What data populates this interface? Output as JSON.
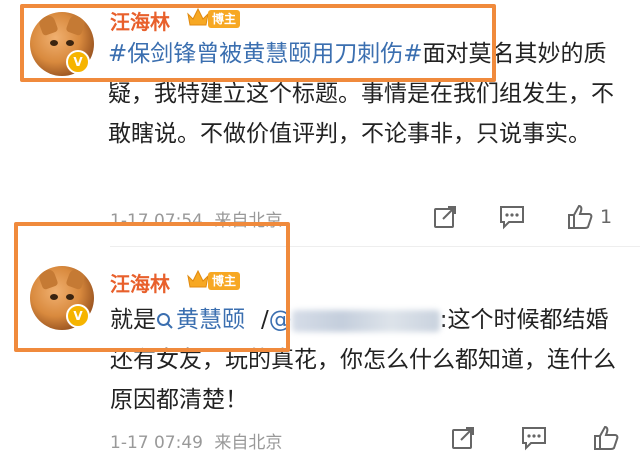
{
  "comments": [
    {
      "user": "汪海林",
      "role_badge": "博主",
      "verified_mark": "V",
      "hashtag": "#保剑锋曾被黄慧颐用刀刺伤#",
      "text_after_hashtag": "面对莫名其妙的质疑，我特建立这个标题。事情是在我们组发生，不敢瞎说。不做价值评判，不论事非，只说事实。",
      "date": "1-17 07:54",
      "source": "来自北京",
      "like_count": "1",
      "icons": [
        "share-icon",
        "comment-icon",
        "like-icon"
      ]
    },
    {
      "user": "汪海林",
      "role_badge": "博主",
      "verified_mark": "V",
      "prefix": "就是",
      "mention_name": "黄慧颐",
      "reply_sep": "/",
      "at_handle": "@",
      "text_after_handle": ":这个时候都结婚还有女友，玩的真花，你怎么什么都知道，连什么原因都清楚！",
      "date": "1-17 07:49",
      "source": "来自北京",
      "icons": [
        "share-icon",
        "comment-icon",
        "like-icon"
      ]
    }
  ],
  "colors": {
    "highlight": "#f08a3c",
    "username": "#e8602c",
    "link": "#3b6fb0",
    "badge": "#f7a823"
  }
}
